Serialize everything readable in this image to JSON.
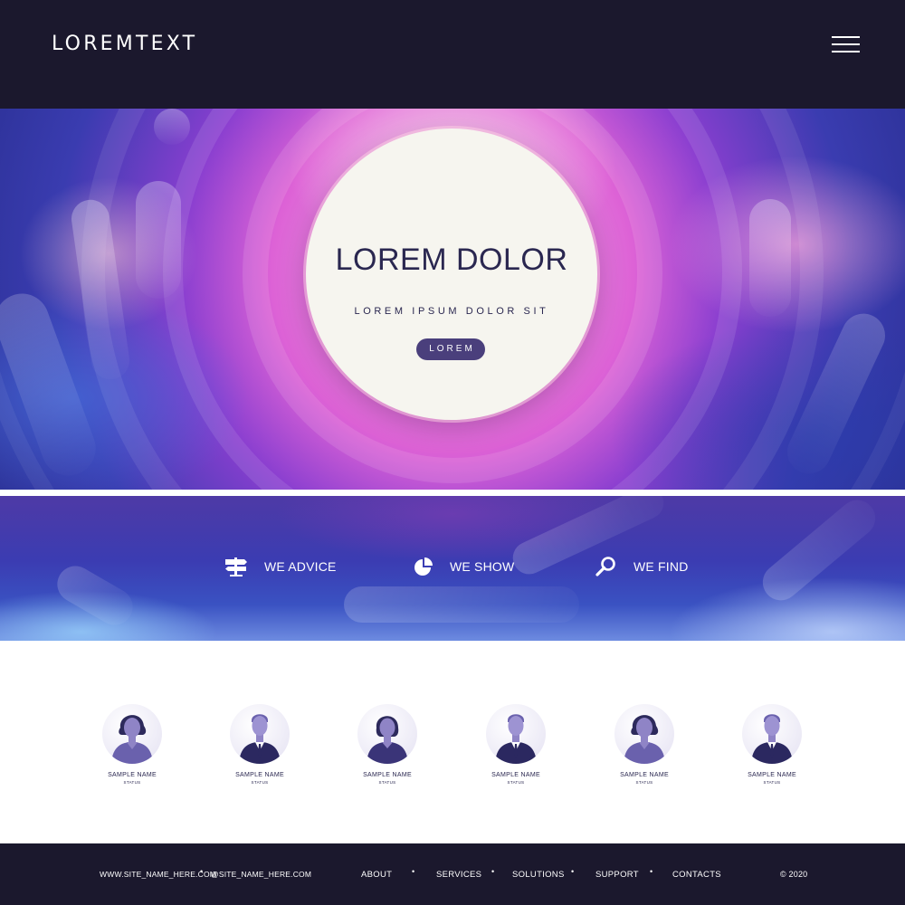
{
  "header": {
    "logo_text": "LOREMTEXT",
    "menu_icon": "hamburger-menu-icon",
    "background": "#1b182d"
  },
  "hero": {
    "title": "LOREM DOLOR",
    "subtitle": "LOREM IPSUM DOLOR SIT",
    "button_label": "LOREM",
    "accent": "#4a3f7c"
  },
  "features": [
    {
      "label": "WE ADVICE",
      "icon": "signpost-icon"
    },
    {
      "label": "WE SHOW",
      "icon": "pie-chart-icon"
    },
    {
      "label": "WE FIND",
      "icon": "magnifier-icon"
    }
  ],
  "team": [
    {
      "name": "SAMPLE NAME",
      "status": "STATUS",
      "avatar": "female-avatar-icon"
    },
    {
      "name": "SAMPLE NAME",
      "status": "STATUS",
      "avatar": "male-avatar-icon"
    },
    {
      "name": "SAMPLE NAME",
      "status": "STATUS",
      "avatar": "female-avatar-icon"
    },
    {
      "name": "SAMPLE NAME",
      "status": "STATUS",
      "avatar": "male-avatar-icon"
    },
    {
      "name": "SAMPLE NAME",
      "status": "STATUS",
      "avatar": "female-avatar-icon"
    },
    {
      "name": "SAMPLE NAME",
      "status": "STATUS",
      "avatar": "male-avatar-icon"
    }
  ],
  "footer": {
    "website": "WWW.SITE_NAME_HERE.COM",
    "separator": "•",
    "social": "@SITE_NAME_HERE.COM",
    "nav": [
      "ABOUT",
      "SERVICES",
      "SOLUTIONS",
      "SUPPORT",
      "CONTACTS"
    ],
    "copyright": "© 2020"
  }
}
